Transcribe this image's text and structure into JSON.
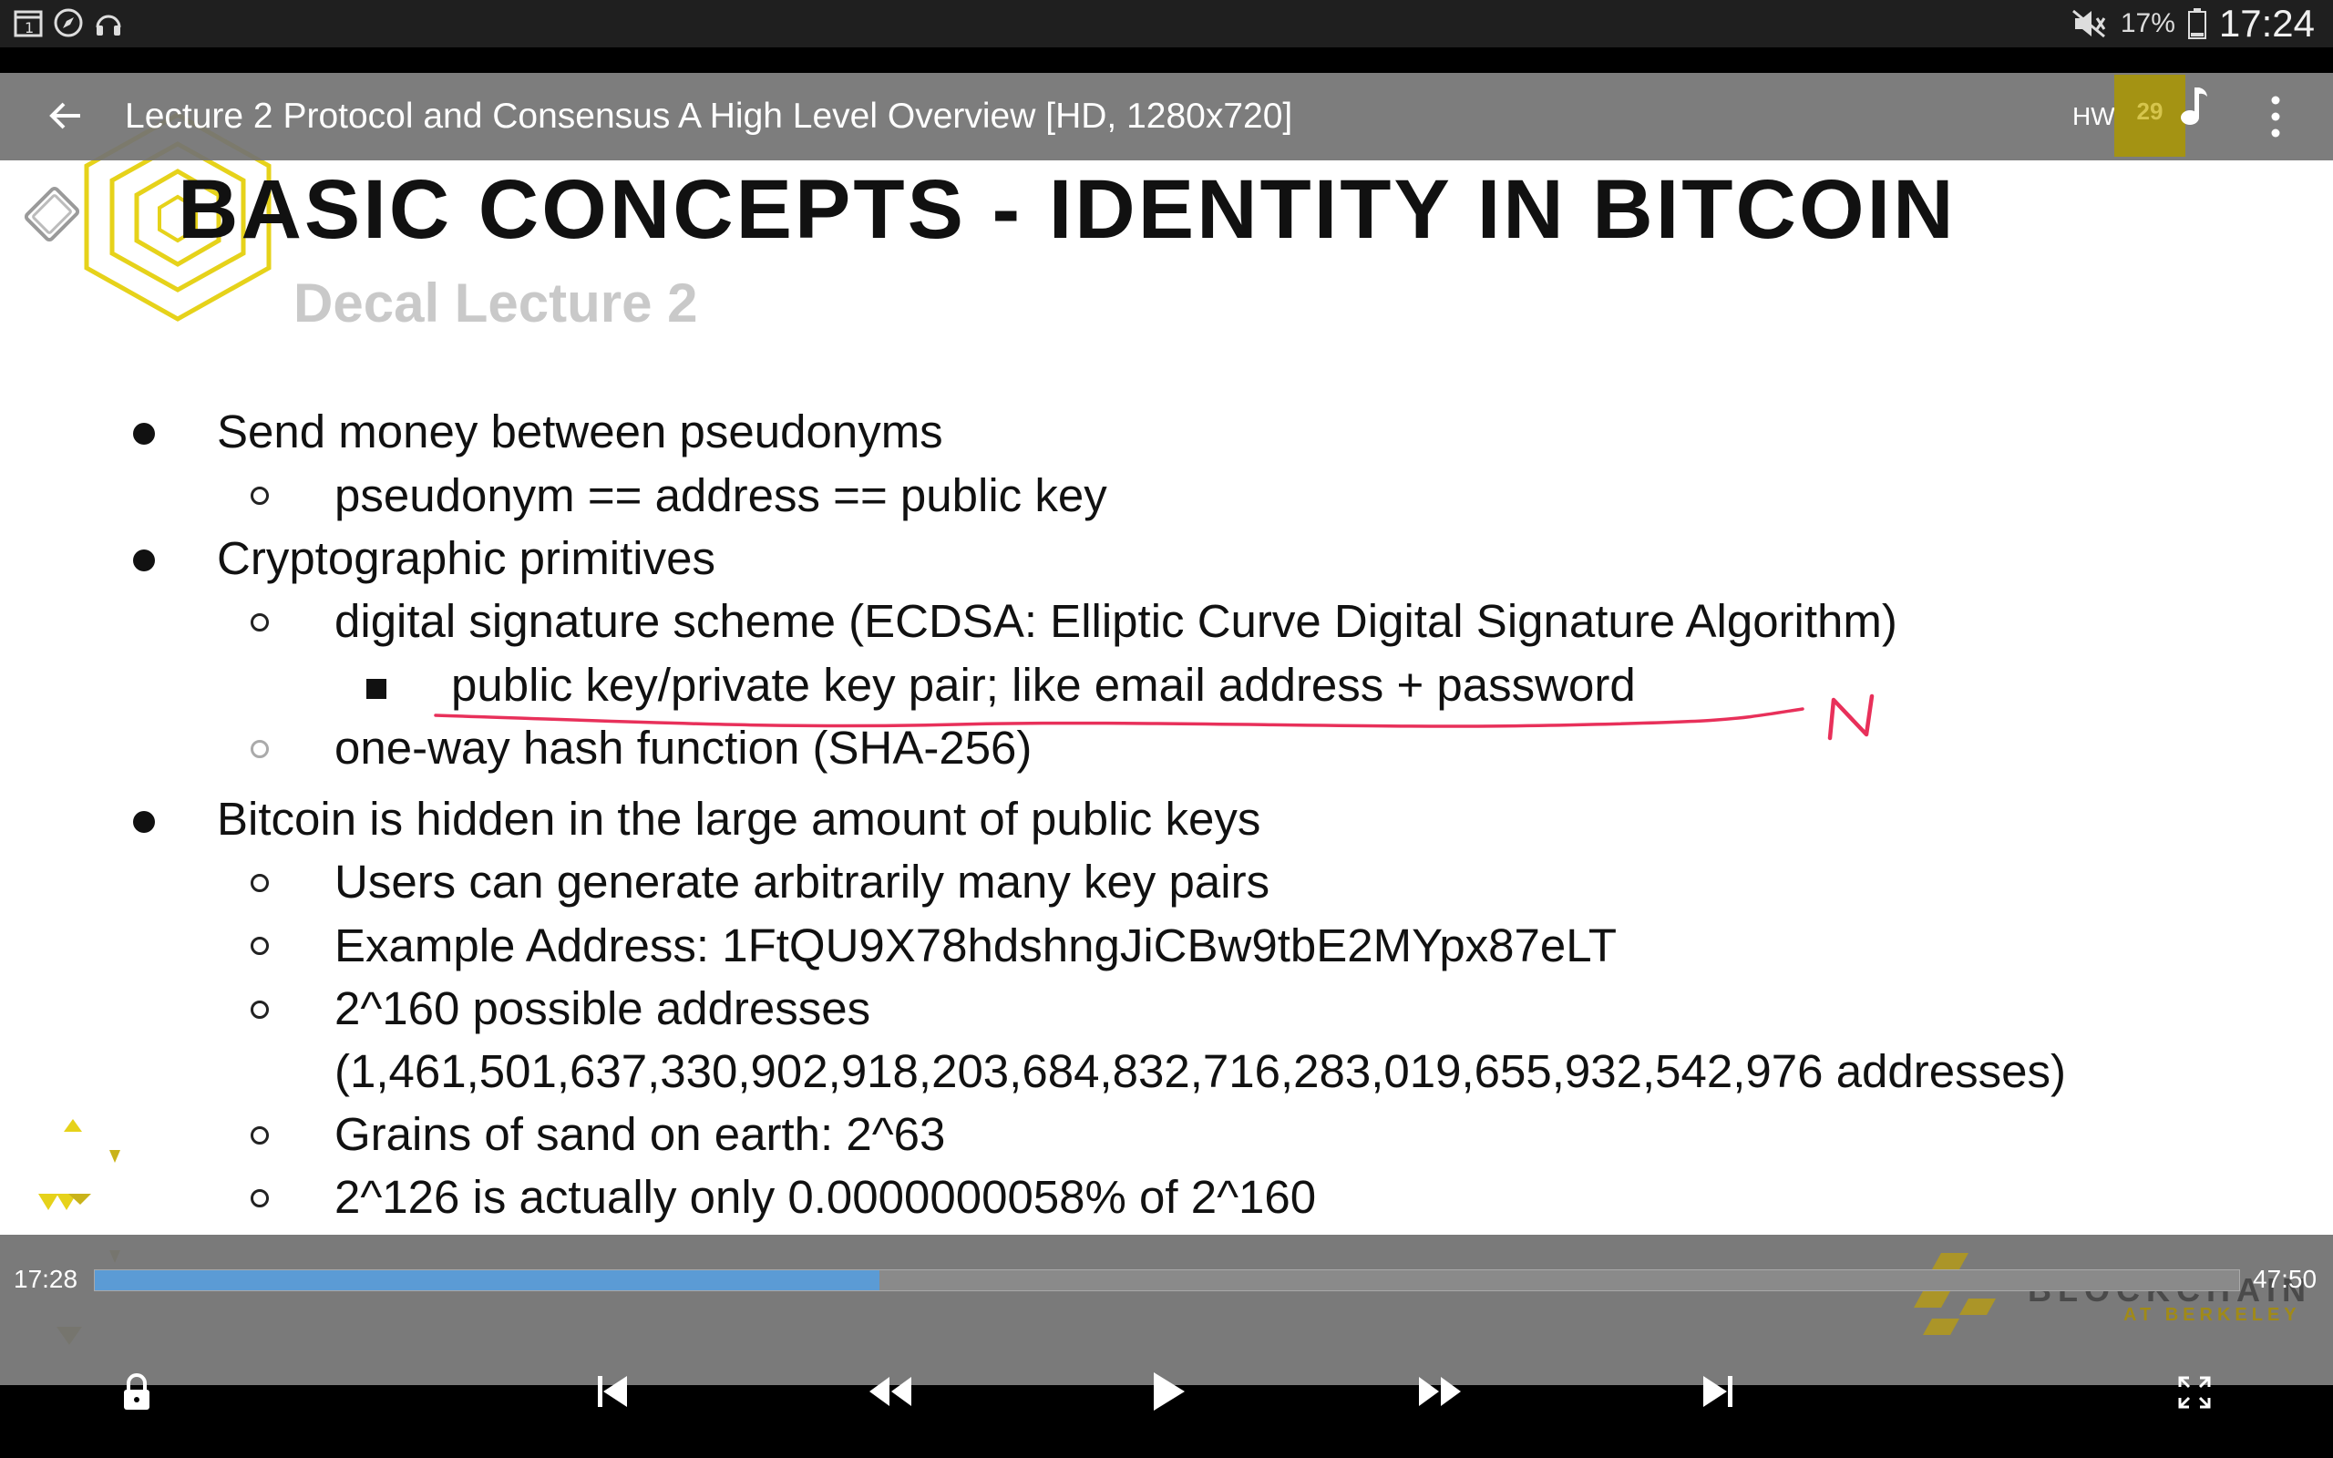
{
  "status_bar": {
    "battery": "17%",
    "time": "17:24"
  },
  "title_bar": {
    "title": "Lecture 2 Protocol and Consensus A High Level Overview [HD, 1280x720]",
    "hw_label": "HW",
    "badge": "29"
  },
  "slide": {
    "title": "BASIC CONCEPTS - IDENTITY IN BITCOIN",
    "subtitle": "Decal Lecture 2",
    "lines": [
      "Send money between pseudonyms",
      "pseudonym == address == public key",
      "Cryptographic primitives",
      "digital signature scheme (ECDSA: Elliptic Curve Digital Signature Algorithm)",
      "public key/private key pair; like email address + password",
      "one-way hash function (SHA-256)",
      "Bitcoin is hidden in the large amount of public keys",
      "Users can generate arbitrarily many key pairs",
      "Example Address: 1FtQU9X78hdshngJiCBw9tbE2MYpx87eLT",
      "2^160 possible addresses",
      "(1,461,501,637,330,902,918,203,684,832,716,283,019,655,932,542,976 addresses)",
      "Grains of sand on earth: 2^63",
      "2^126 is actually only 0.0000000058% of 2^160"
    ],
    "handwritten_annotation": "N",
    "annotation_color": "#e8305a",
    "accent_color": "#e6d21a"
  },
  "player": {
    "elapsed": "17:28",
    "total": "47:50",
    "progress": 0.366,
    "progress_color": "#5b9bd5"
  },
  "watermark": {
    "line1": "BLOCKCHAIN",
    "line2": "AT BERKELEY"
  },
  "icons": [
    "calendar-icon",
    "compass-icon",
    "headphones-icon",
    "mute-icon",
    "battery-icon",
    "back-arrow-icon",
    "music-note-icon",
    "more-vert-icon",
    "rotate-icon",
    "lock-icon",
    "skip-previous-icon",
    "rewind-icon",
    "play-icon",
    "fast-forward-icon",
    "skip-next-icon",
    "fullscreen-icon"
  ]
}
